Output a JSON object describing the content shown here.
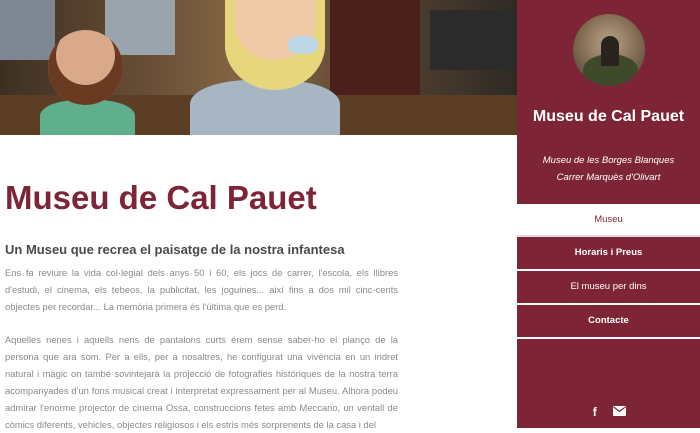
{
  "main": {
    "title": "Museu de Cal Pauet",
    "subtitle": "Un Museu que recrea el paisatge de la nostra infantesa",
    "paragraph1": "Ens fa reviure la vida col·legial dels anys 50 i 60, els jocs de carrer, l'escola, els llibres d'estudi, el cinema, els tebeos, la publicitat, les joguines... així fins a dos mil cinc-cents objectes per recordar... La memòria primera és l'última que es perd.",
    "paragraph2": "Aquelles nenes i aquells nens de pantalons curts érem sense saber-ho el planço de la persona que ara som. Per a ells, per a nosaltres, he configurat una vivència en un indret natural i màgic on també sovintejarà la projecció de fotografies històriques de la nostra terra acompanyades d'un fons musical creat i interpretat expressament per al Museu. Alhora podeu admirar l'enorme projector de cinema Ossa, construccions fetes amb Meccano, un ventall de còmics diferents, vehicles, objectes religiosos i els estris més sorprenents de la casa i del"
  },
  "sidebar": {
    "title": "Museu de Cal Pauet",
    "subtitle_line1": "Museu de les Borges Blanques",
    "subtitle_line2": "Carrer Marquès d'Olivart",
    "nav": [
      {
        "label": "Museu"
      },
      {
        "label": "Horaris i Preus"
      },
      {
        "label": "El museu per dins"
      },
      {
        "label": "Contacte"
      }
    ],
    "icons": [
      "facebook-icon",
      "mail-icon"
    ]
  },
  "colors": {
    "brand": "#7d2536"
  }
}
